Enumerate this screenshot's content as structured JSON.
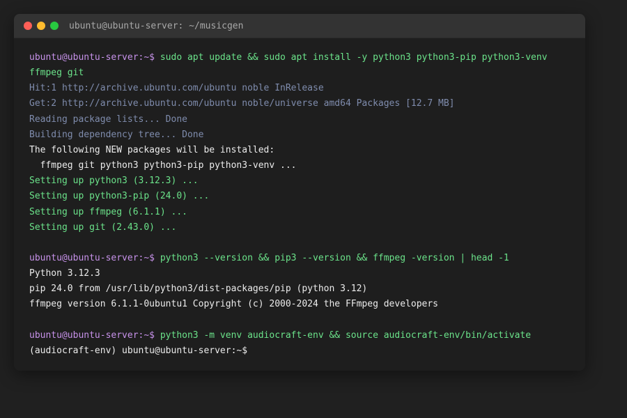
{
  "window": {
    "title": "ubuntu@ubuntu-server: ~/musicgen",
    "colors": {
      "close": "#ff5f57",
      "minimize": "#febc2e",
      "maximize": "#28c840"
    }
  },
  "terminal": {
    "prompt": "ubuntu@ubuntu-server:~$",
    "lines": [
      {
        "kind": "cmd",
        "prompt": "ubuntu@ubuntu-server:~$",
        "text": " sudo apt update && sudo apt install -y python3 python3-pip python3-venv"
      },
      {
        "kind": "cmd-cont",
        "text": "ffmpeg git"
      },
      {
        "kind": "info",
        "text": "Hit:1 http://archive.ubuntu.com/ubuntu noble InRelease"
      },
      {
        "kind": "info",
        "text": "Get:2 http://archive.ubuntu.com/ubuntu noble/universe amd64 Packages [12.7 MB]"
      },
      {
        "kind": "info",
        "text": "Reading package lists... Done"
      },
      {
        "kind": "info",
        "text": "Building dependency tree... Done"
      },
      {
        "kind": "plain",
        "text": "The following NEW packages will be installed:"
      },
      {
        "kind": "plain",
        "text": "  ffmpeg git python3 python3-pip python3-venv ..."
      },
      {
        "kind": "ok",
        "text": "Setting up python3 (3.12.3) ..."
      },
      {
        "kind": "ok",
        "text": "Setting up python3-pip (24.0) ..."
      },
      {
        "kind": "ok",
        "text": "Setting up ffmpeg (6.1.1) ..."
      },
      {
        "kind": "ok",
        "text": "Setting up git (2.43.0) ..."
      },
      {
        "kind": "blank",
        "text": ""
      },
      {
        "kind": "cmd",
        "prompt": "ubuntu@ubuntu-server:~$",
        "text": " python3 --version && pip3 --version && ffmpeg -version | head -1"
      },
      {
        "kind": "plain",
        "text": "Python 3.12.3"
      },
      {
        "kind": "plain",
        "text": "pip 24.0 from /usr/lib/python3/dist-packages/pip (python 3.12)"
      },
      {
        "kind": "plain",
        "text": "ffmpeg version 6.1.1-0ubuntu1 Copyright (c) 2000-2024 the FFmpeg developers"
      },
      {
        "kind": "blank",
        "text": ""
      },
      {
        "kind": "cmd",
        "prompt": "ubuntu@ubuntu-server:~$",
        "text": " python3 -m venv audiocraft-env && source audiocraft-env/bin/activate"
      },
      {
        "kind": "plain",
        "text": "(audiocraft-env) ubuntu@ubuntu-server:~$"
      }
    ]
  }
}
